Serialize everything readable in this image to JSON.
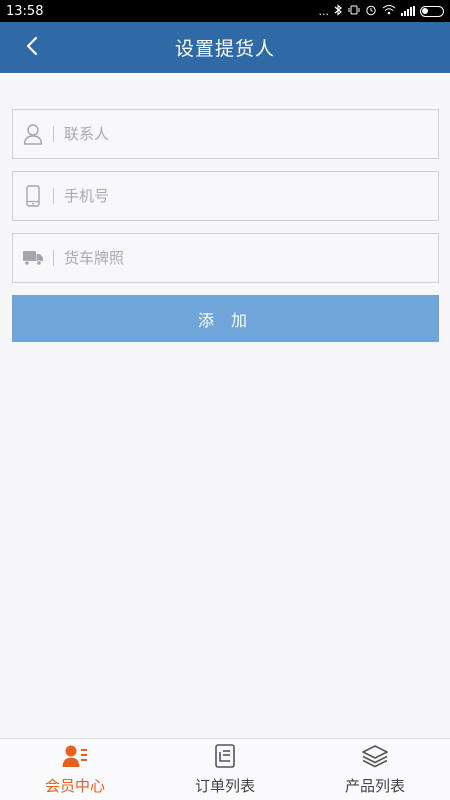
{
  "status_bar": {
    "time": "13:58",
    "indicators": "..."
  },
  "header": {
    "title": "设置提货人",
    "back_icon": "chevron-left-icon"
  },
  "form": {
    "contact": {
      "placeholder": "联系人",
      "icon": "person-icon",
      "value": ""
    },
    "phone": {
      "placeholder": "手机号",
      "icon": "phone-icon",
      "value": ""
    },
    "plate": {
      "placeholder": "货车牌照",
      "icon": "truck-icon",
      "value": ""
    },
    "submit_label": "添 加"
  },
  "tabs": [
    {
      "label": "会员中心",
      "icon": "member-icon",
      "active": true
    },
    {
      "label": "订单列表",
      "icon": "order-list-icon",
      "active": false
    },
    {
      "label": "产品列表",
      "icon": "product-layers-icon",
      "active": false
    }
  ],
  "colors": {
    "header_bg": "#2f6aa6",
    "button_bg": "#6fa5d8",
    "active_tab": "#e8601e",
    "page_bg": "#f7f6f9"
  }
}
